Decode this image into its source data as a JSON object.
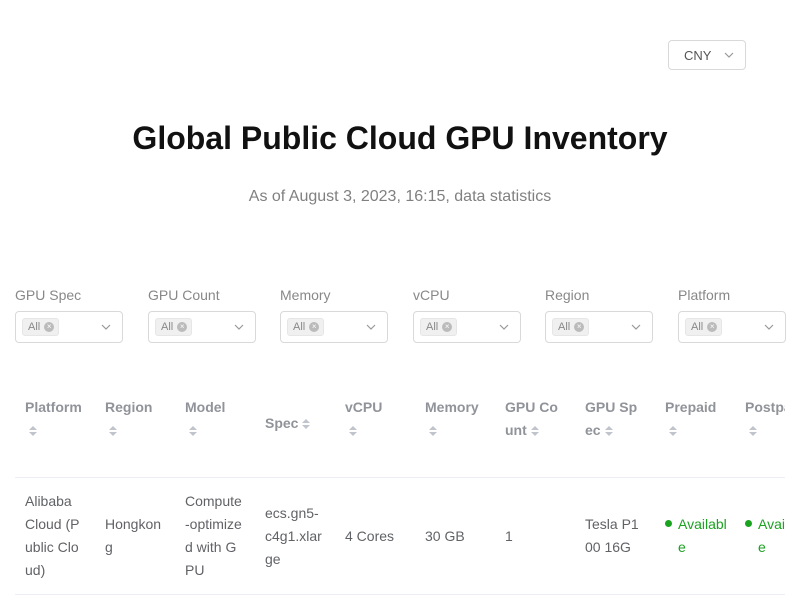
{
  "currency": {
    "selected": "CNY"
  },
  "header": {
    "title": "Global Public Cloud GPU Inventory",
    "subtitle": "As of August 3, 2023, 16:15, data statistics"
  },
  "filters": [
    {
      "label": "GPU Spec",
      "value": "All"
    },
    {
      "label": "GPU Count",
      "value": "All"
    },
    {
      "label": "Memory",
      "value": "All"
    },
    {
      "label": "vCPU",
      "value": "All"
    },
    {
      "label": "Region",
      "value": "All"
    },
    {
      "label": "Platform",
      "value": "All"
    }
  ],
  "table": {
    "columns": [
      "Platform",
      "Region",
      "Model",
      "Spec",
      "vCPU",
      "Memory",
      "GPU Count",
      "GPU Spec",
      "Prepaid",
      "Postpaid"
    ],
    "rows": [
      {
        "platform": "Alibaba Cloud (Public Cloud)",
        "region": "Hongkong",
        "model": "Compute-optimized with GPU",
        "spec": "ecs.gn5-c4g1.xlarge",
        "vcpu": "4 Cores",
        "memory": "30 GB",
        "gpu_count": "1",
        "gpu_spec": "Tesla P100 16G",
        "prepaid": "Available",
        "postpaid": "Available"
      }
    ]
  },
  "colors": {
    "available": "#19a31f",
    "header_text": "#909399"
  }
}
